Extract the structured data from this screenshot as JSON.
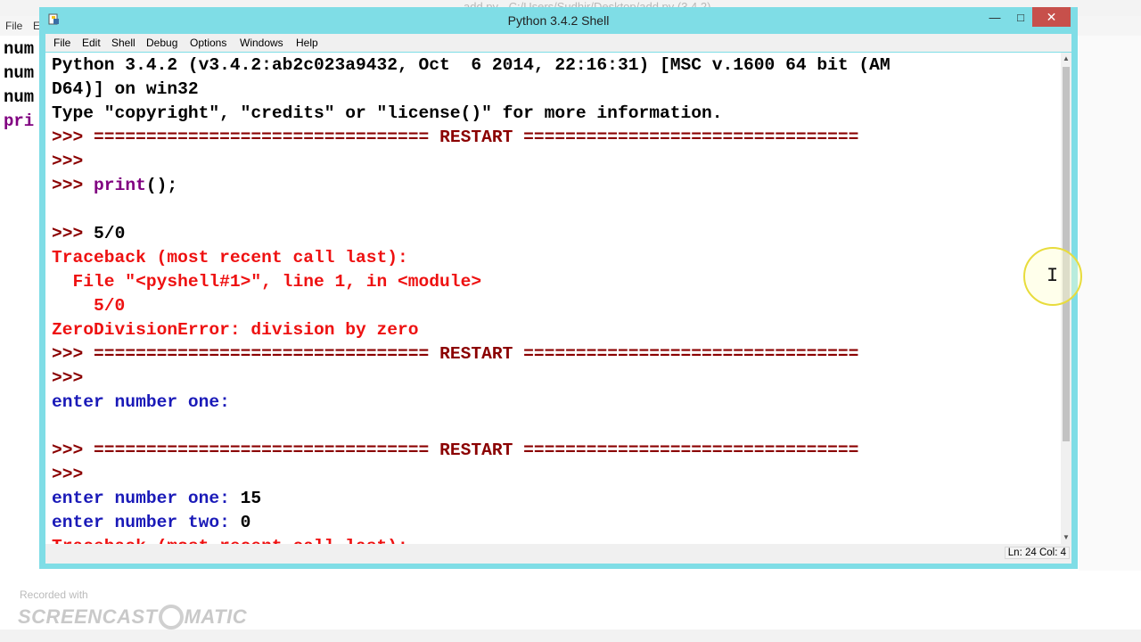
{
  "background_window": {
    "title": "add.py - C:/Users/Sudhir/Desktop/add.py (3.4.2)",
    "menu": [
      "File",
      "E"
    ],
    "code_lines": [
      "num",
      "num",
      "num",
      "pri"
    ]
  },
  "shell": {
    "title": "Python 3.4.2 Shell",
    "menu": [
      "File",
      "Edit",
      "Shell",
      "Debug",
      "Options",
      "Windows",
      "Help"
    ],
    "lines": [
      {
        "segments": [
          {
            "t": "Python 3.4.2 (v3.4.2:ab2c023a9432, Oct  6 2014, 22:16:31) [MSC v.1600 64 bit (AM",
            "c": "black"
          }
        ]
      },
      {
        "segments": [
          {
            "t": "D64)] on win32",
            "c": "black"
          }
        ]
      },
      {
        "segments": [
          {
            "t": "Type \"copyright\", \"credits\" or \"license()\" for more information.",
            "c": "black"
          }
        ]
      },
      {
        "segments": [
          {
            "t": ">>> ",
            "c": "prompt"
          },
          {
            "t": "================================ RESTART ================================",
            "c": "prompt"
          }
        ]
      },
      {
        "segments": [
          {
            "t": ">>> ",
            "c": "prompt"
          }
        ]
      },
      {
        "segments": [
          {
            "t": ">>> ",
            "c": "prompt"
          },
          {
            "t": "print",
            "c": "purple"
          },
          {
            "t": "();",
            "c": "black"
          }
        ]
      },
      {
        "segments": [
          {
            "t": "",
            "c": "black"
          }
        ]
      },
      {
        "segments": [
          {
            "t": ">>> ",
            "c": "prompt"
          },
          {
            "t": "5/0",
            "c": "black"
          }
        ]
      },
      {
        "segments": [
          {
            "t": "Traceback (most recent call last):",
            "c": "err"
          }
        ]
      },
      {
        "segments": [
          {
            "t": "  File \"<pyshell#1>\", line 1, in <module>",
            "c": "err"
          }
        ]
      },
      {
        "segments": [
          {
            "t": "    5/0",
            "c": "err"
          }
        ]
      },
      {
        "segments": [
          {
            "t": "ZeroDivisionError: division by zero",
            "c": "err"
          }
        ]
      },
      {
        "segments": [
          {
            "t": ">>> ",
            "c": "prompt"
          },
          {
            "t": "================================ RESTART ================================",
            "c": "prompt"
          }
        ]
      },
      {
        "segments": [
          {
            "t": ">>> ",
            "c": "prompt"
          }
        ]
      },
      {
        "segments": [
          {
            "t": "enter number one:",
            "c": "blue"
          }
        ]
      },
      {
        "segments": [
          {
            "t": "",
            "c": "black"
          }
        ]
      },
      {
        "segments": [
          {
            "t": ">>> ",
            "c": "prompt"
          },
          {
            "t": "================================ RESTART ================================",
            "c": "prompt"
          }
        ]
      },
      {
        "segments": [
          {
            "t": ">>> ",
            "c": "prompt"
          }
        ]
      },
      {
        "segments": [
          {
            "t": "enter number one: ",
            "c": "blue"
          },
          {
            "t": "15",
            "c": "black"
          }
        ]
      },
      {
        "segments": [
          {
            "t": "enter number two: ",
            "c": "blue"
          },
          {
            "t": "0",
            "c": "black"
          }
        ]
      },
      {
        "segments": [
          {
            "t": "Traceback (most recent call last):",
            "c": "err"
          }
        ]
      }
    ],
    "status": "Ln: 24 Col: 4",
    "window_buttons": {
      "minimize": "—",
      "maximize": "□",
      "close": "✕"
    }
  },
  "watermark": {
    "recorded_with": "Recorded with",
    "brand_left": "SCREENCAST",
    "brand_right": "MATIC"
  },
  "colors": {
    "window_frame": "#7fdde6",
    "prompt": "#8b0000",
    "error": "#ee1111",
    "output_blue": "#1a1ab8",
    "builtin_purple": "#800080"
  }
}
